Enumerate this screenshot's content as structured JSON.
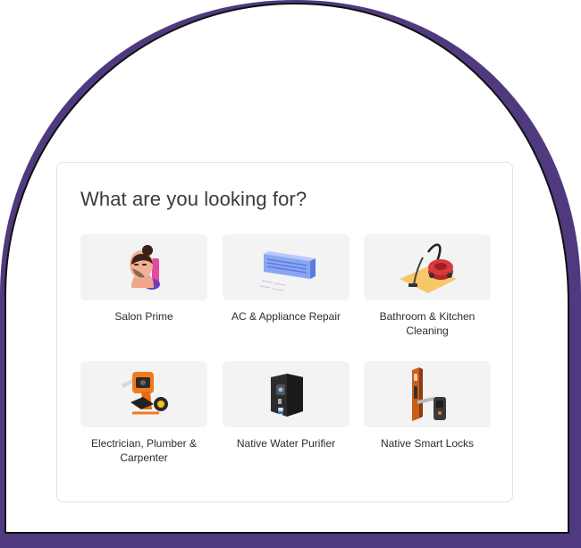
{
  "section": {
    "title": "What are you looking for?"
  },
  "services": [
    {
      "label": "Salon Prime",
      "icon": "woman-face-mask-icon"
    },
    {
      "label": "AC & Appliance Repair",
      "icon": "air-conditioner-icon"
    },
    {
      "label": "Bathroom & Kitchen Cleaning",
      "icon": "vacuum-cleaner-icon"
    },
    {
      "label": "Electrician, Plumber & Carpenter",
      "icon": "power-drill-icon"
    },
    {
      "label": "Native Water Purifier",
      "icon": "water-purifier-icon"
    },
    {
      "label": "Native Smart Locks",
      "icon": "smart-lock-icon"
    }
  ],
  "colors": {
    "frame": "#4f3a80",
    "arch_outline": "#111111",
    "tile_background": "#f3f3f3",
    "card_border": "#e3e3e3"
  }
}
